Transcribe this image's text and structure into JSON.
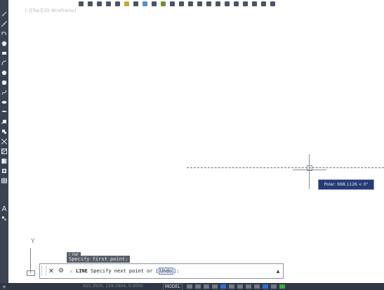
{
  "window": {
    "drawing_tab_caption": "[-][Top][2D Wireframe]"
  },
  "left_toolbar": {
    "tools": [
      {
        "name": "line-icon"
      },
      {
        "name": "construction-line-icon"
      },
      {
        "name": "polyline-icon"
      },
      {
        "name": "polygon-icon"
      },
      {
        "name": "rectangle-icon"
      },
      {
        "name": "arc-icon"
      },
      {
        "name": "circle-icon"
      },
      {
        "name": "revision-cloud-icon"
      },
      {
        "name": "spline-icon"
      },
      {
        "name": "ellipse-icon"
      },
      {
        "name": "ellipse-arc-icon"
      },
      {
        "name": "insert-block-icon"
      },
      {
        "name": "make-block-icon"
      },
      {
        "name": "point-icon"
      },
      {
        "name": "hatch-icon"
      },
      {
        "name": "gradient-icon"
      },
      {
        "name": "region-icon"
      },
      {
        "name": "table-icon"
      },
      {
        "name": "multiline-text-icon",
        "text": "A"
      },
      {
        "name": "add-selected-icon"
      }
    ]
  },
  "canvas": {
    "polar_tooltip": "Polar: 698.1126 < 0°"
  },
  "ucs": {
    "y_label": "Y"
  },
  "command_history": {
    "tag": "LINE",
    "line": "Specify first point:"
  },
  "command_line": {
    "prompt_prefix": "LINE",
    "prompt_text": " Specify next point or [",
    "option_undo": "Undo",
    "prompt_suffix": "]:"
  },
  "status_bar": {
    "coords": "925.3500, 228.3904, 0.0000",
    "model_label": "MODEL"
  }
}
